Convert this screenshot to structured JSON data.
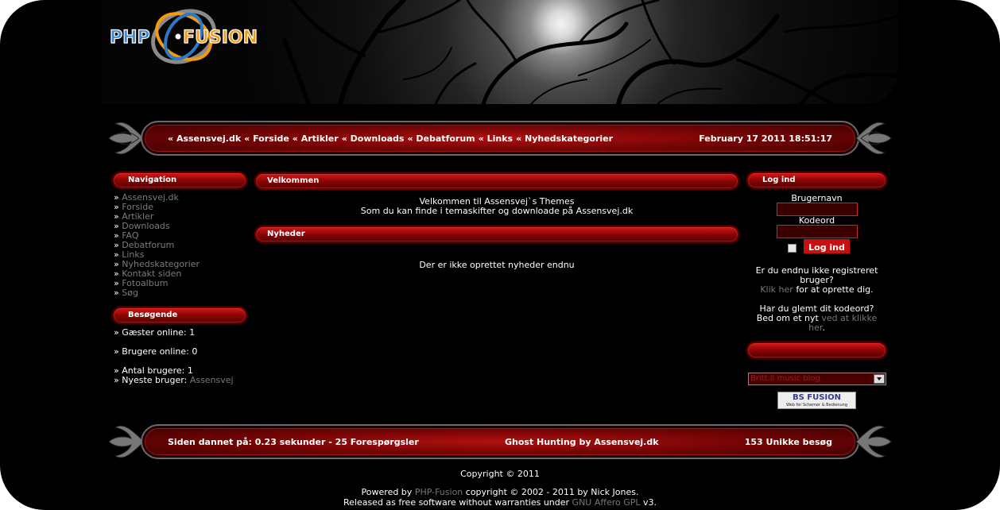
{
  "logo": {
    "part1": "PHP",
    "part2": "FUSION"
  },
  "nav": {
    "links": [
      "Assensvej.dk",
      "Forside",
      "Artikler",
      "Downloads",
      "Debatforum",
      "Links",
      "Nyhedskategorier"
    ],
    "datetime": "February 17 2011 18:51:17"
  },
  "navigation": {
    "title": "Navigation",
    "items": [
      "Assensvej.dk",
      "Forside",
      "Artikler",
      "Downloads",
      "FAQ",
      "Debatforum",
      "Links",
      "Nyhedskategorier",
      "Kontakt siden",
      "Fotoalbum",
      "Søg"
    ]
  },
  "visitors": {
    "title": "Besøgende",
    "guests": "Gæster online: 1",
    "users": "Brugere online: 0",
    "total": "Antal brugere: 1",
    "newest_label": "Nyeste bruger:",
    "newest_user": "Assensvej"
  },
  "welcome": {
    "title": "Velkommen",
    "line1": "Velkommen til Assensvej`s Themes",
    "line2": "Som du kan finde i temaskifter og downloade på Assensvej.dk"
  },
  "news": {
    "title": "Nyheder",
    "empty": "Der er ikke oprettet nyheder endnu"
  },
  "login": {
    "title": "Log ind",
    "username_label": "Brugernavn",
    "password_label": "Kodeord",
    "button": "Log ind",
    "not_registered": "Er du endnu ikke registreret bruger?",
    "click_here": "Klik her",
    "to_register": "for at oprette dig.",
    "forgot": "Har du glemt dit kodeord?",
    "ask_new": "Bed om et nyt",
    "ask_link": "ved at klikke her",
    "period": "."
  },
  "music": {
    "selected": "Britt.ll  music  blog"
  },
  "badge": {
    "text": "BS FUSION",
    "sub": "Web for Schemer & Bedienung"
  },
  "footer": {
    "generated": "Siden dannet på: 0.23 sekunder - 25 Forespørgsler",
    "theme": "Ghost Hunting by  Assensvej.dk",
    "unique": "153 Unikke besøg",
    "copyright": "Copyright © 2011",
    "powered_by": "Powered by",
    "php_fusion": "PHP-Fusion",
    "copyright_line": "copyright © 2002 - 2011 by Nick Jones.",
    "released": "Released as free software without warranties under",
    "license": "GNU Affero GPL",
    "version": "v3."
  },
  "colors": {
    "accent": "#b01010",
    "link": "#7b7b7b"
  }
}
